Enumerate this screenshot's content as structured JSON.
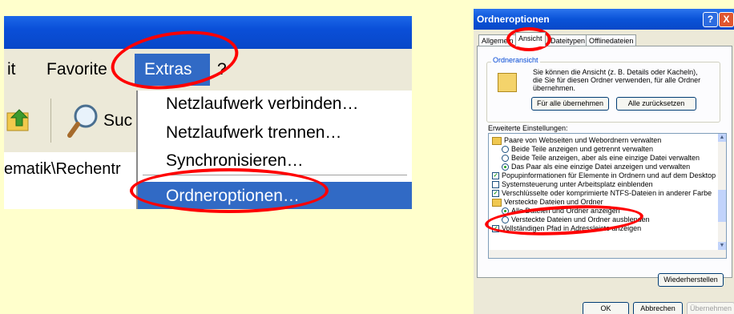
{
  "menubar": {
    "item_1": "it",
    "item_2": "Favorite",
    "extras": "Extras",
    "help": "?"
  },
  "toolbar": {
    "search_fragment": "Suc"
  },
  "address": {
    "text": "ematik\\Rechentr"
  },
  "extras_menu": {
    "items": [
      "Netzlaufwerk verbinden…",
      "Netzlaufwerk trennen…",
      "Synchronisieren…"
    ],
    "highlighted": "Ordneroptionen…"
  },
  "dialog": {
    "title": "Ordneroptionen",
    "help_button": "?",
    "close_button": "X",
    "tabs": [
      "Allgemein",
      "Ansicht",
      "Dateitypen",
      "Offlinedateien"
    ],
    "group_label": "Ordneransicht",
    "group_description": "Sie können die Ansicht (z. B. Details oder Kacheln), die Sie für diesen Ordner verwenden, für alle Ordner übernehmen.",
    "apply_all_button": "Für alle übernehmen",
    "reset_all_button": "Alle zurücksetzen",
    "advanced_label": "Erweiterte Einstellungen:",
    "settings": [
      {
        "type": "folder",
        "label": "Paare von Webseiten und Webordnern verwalten"
      },
      {
        "type": "radio",
        "checked": false,
        "label": "Beide Teile anzeigen und getrennt verwalten"
      },
      {
        "type": "radio",
        "checked": false,
        "label": "Beide Teile anzeigen, aber als eine einzige Datei verwalten"
      },
      {
        "type": "radio",
        "checked": true,
        "label": "Das Paar als eine einzige Datei anzeigen und verwalten"
      },
      {
        "type": "check",
        "checked": true,
        "label": "Popupinformationen für Elemente in Ordnern und auf dem Desktop"
      },
      {
        "type": "check",
        "checked": false,
        "label": "Systemsteuerung unter Arbeitsplatz einblenden"
      },
      {
        "type": "check",
        "checked": true,
        "label": "Verschlüsselte oder komprimierte NTFS-Dateien in anderer Farbe"
      },
      {
        "type": "folder",
        "label": "Versteckte Dateien und Ordner"
      },
      {
        "type": "radio",
        "checked": true,
        "label": "Alle Dateien und Ordner anzeigen"
      },
      {
        "type": "radio",
        "checked": false,
        "label": "Versteckte Dateien und Ordner ausblenden"
      },
      {
        "type": "check",
        "checked": true,
        "label": "Vollständigen Pfad in Adressleiste anzeigen"
      }
    ],
    "restore_button": "Wiederherstellen",
    "ok_button": "OK",
    "cancel_button": "Abbrechen",
    "apply_button": "Übernehmen"
  }
}
